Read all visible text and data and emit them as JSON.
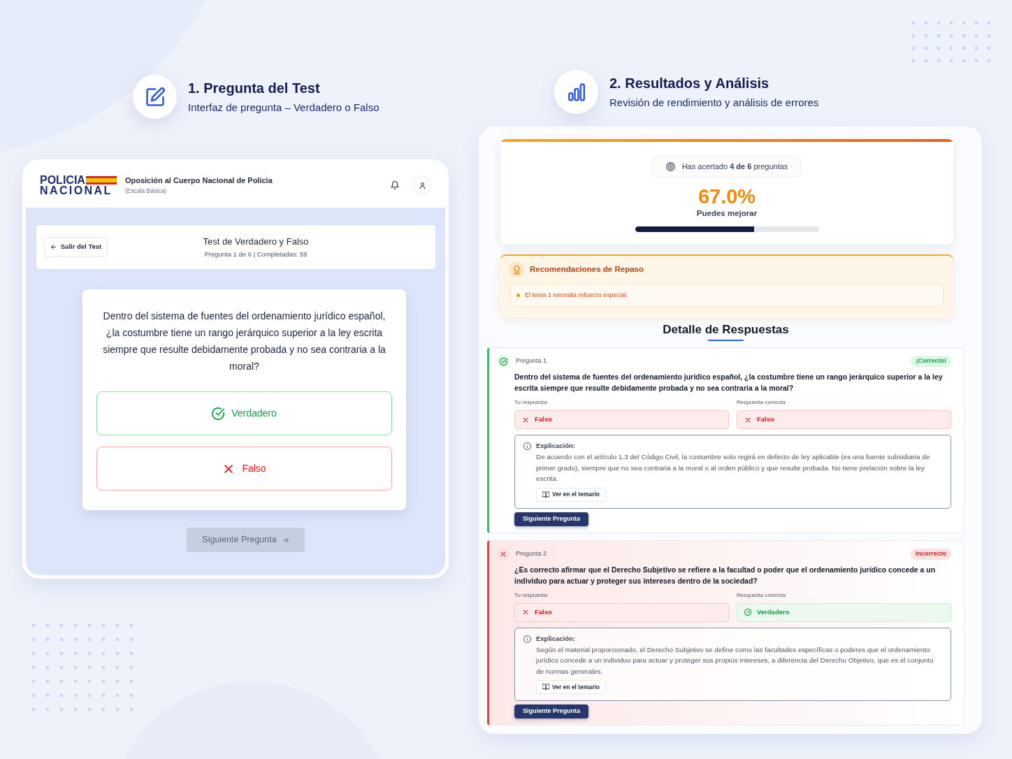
{
  "question_panel": {
    "heading": {
      "title": "1. Pregunta del Test",
      "subtitle": "Interfaz de pregunta – Verdadero o Falso"
    },
    "app_header": {
      "logo": [
        "POLICIA",
        "NACIONAL"
      ],
      "title": "Oposición al Cuerpo Nacional de Policia",
      "subtitle": "(Escala Básica)"
    },
    "test_bar": {
      "exit_button": "Salir del Test",
      "title": "Test de Verdadero y Falso",
      "subtitle": "Pregunta 1 de 6 | Completadas: 59"
    },
    "question": "Dentro del sistema de fuentes del ordenamiento jurídico español, ¿la costumbre tiene un rango jerárquico superior a la ley escrita siempre que resulte debidamente probada y no sea contraria a la moral?",
    "options": [
      {
        "label": "Verdadero",
        "kind": "true"
      },
      {
        "label": "Falso",
        "kind": "false"
      }
    ],
    "next_button": {
      "label": "Siguiente Pregunta",
      "disabled": true
    }
  },
  "results_panel": {
    "heading": {
      "title": "2. Resultados y Análisis",
      "subtitle": "Revisión de rendimiento y análisis de errores"
    },
    "score": {
      "summary": "Has acertado **4 de 6** preguntas",
      "percentage": "67.0%",
      "verdict": "Puedes mejorar",
      "level": 0.65
    },
    "recommendations": {
      "title": "Recomendaciones de Repaso",
      "items": [
        "El tema 1 necesita refuerzo especial."
      ]
    },
    "detail_title": "Detalle de Respuestas",
    "answers": [
      {
        "number": "Pregunta 1",
        "correct": true,
        "badge": "¡Correcto!",
        "question": "Dentro del sistema de fuentes del ordenamiento jurídico español, ¿la costumbre tiene un rango jerárquico superior a la ley escrita siempre que resulte debidamente probada y no sea contraria a la moral?",
        "your_answer": {
          "label": "Tu respuesta:",
          "value": "Falso",
          "kind": "false"
        },
        "correct_answer": {
          "label": "Respuesta correcta:",
          "value": "Falso",
          "kind": "false"
        },
        "explanation": {
          "title": "Explicación:",
          "text": "De acuerdo con el artículo 1.3 del Código Civil, la costumbre solo regirá en defecto de ley aplicable (es una fuente subsidiaria de primer grado), siempre que no sea contraria a la moral o al orden público y que resulte probada. No tiene prelación sobre la ley escrita."
        },
        "syllabus_button": "Ver en el temario",
        "next_button": "Siguiente Pregunta"
      },
      {
        "number": "Pregunta 2",
        "correct": false,
        "badge": "Incorrecto",
        "question": "¿Es correcto afirmar que el Derecho Subjetivo se refiere a la facultad o poder que el ordenamiento jurídico concede a un individuo para actuar y proteger sus intereses dentro de la sociedad?",
        "your_answer": {
          "label": "Tu respuesta:",
          "value": "Falso",
          "kind": "false"
        },
        "correct_answer": {
          "label": "Resquesta correcta:",
          "value": "Verdadero",
          "kind": "true"
        },
        "explanation": {
          "title": "Explicación:",
          "text": "Según el material proporcionado, el Derecho Subjetivo se define como las facultades específicas o poderes que el ordenamiento jurídico concede a un individuo para actuar y proteger sus propios intereses, a diferencia del Derecho Objetivo, que es el conjunto de normas generales."
        },
        "syllabus_button": "Ver en el temario",
        "next_button": "Siguiente Pregunta"
      }
    ]
  }
}
